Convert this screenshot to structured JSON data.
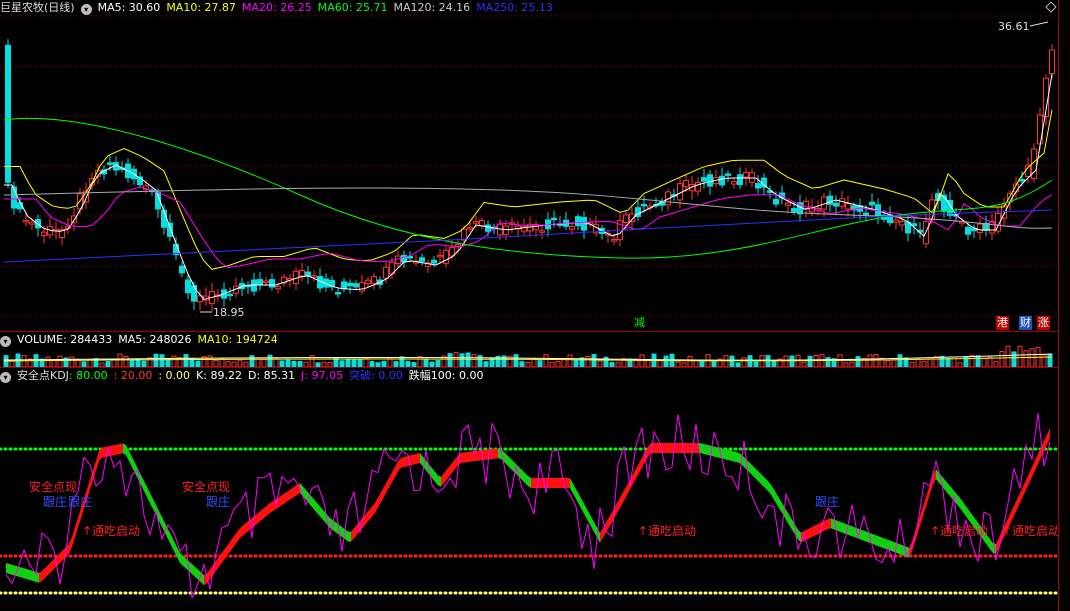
{
  "main": {
    "title": "巨星农牧(日线)",
    "ma5": "MA5: 30.60",
    "ma10": "MA10: 27.87",
    "ma20": "MA20: 26.25",
    "ma60": "MA60: 25.71",
    "ma120": "MA120: 24.16",
    "ma250": "MA250: 25.13",
    "high_label": "36.61",
    "low_label": "18.95",
    "tags": [
      "减",
      "港",
      "财",
      "涨"
    ]
  },
  "volume": {
    "label": "VOLUME: 284433",
    "ma5": "MA5: 248026",
    "ma10": "MA10: 194724"
  },
  "kdj": {
    "name": "安全点KDJ",
    "v1": ": 80.00",
    "v2": ": 20.00",
    "v3": ": 0.00",
    "k": "K: 89.22",
    "d": "D: 85.31",
    "j": "J: 97.05",
    "brk_name": "突破",
    "brk": ": 0.00",
    "amp": "跌幅100: 0.00",
    "annotations": [
      "安全点现",
      "跟庄",
      "跟庄",
      "↑通吃启动",
      "安全点现",
      "跟庄",
      "↑通吃启动",
      "跟庄",
      "↑通吃启动",
      "↑通吃启动"
    ]
  },
  "colors": {
    "up": "#ff3232",
    "down": "#00e0e0",
    "ma5": "#ffffff",
    "ma10": "#ffff00",
    "ma20": "#ff00ff",
    "ma60": "#00ff00",
    "ma120": "#aaaaaa",
    "ma250": "#3030ff"
  }
}
